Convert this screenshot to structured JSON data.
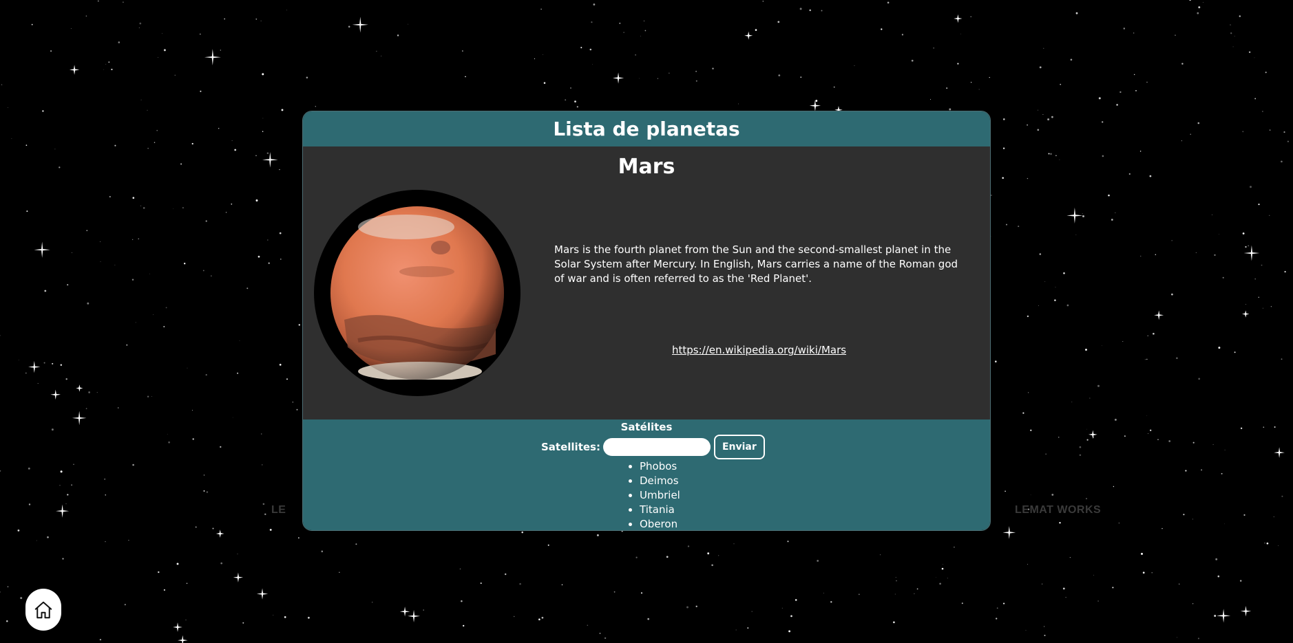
{
  "header": {
    "title": "Lista de planetas"
  },
  "planet": {
    "name": "Mars",
    "description": "Mars is the fourth planet from the Sun and the second-smallest planet in the Solar System after Mercury. In English, Mars carries a name of the Roman god of war and is often referred to as the 'Red Planet'.",
    "link": "https://en.wikipedia.org/wiki/Mars"
  },
  "satellites": {
    "title": "Satélites",
    "label": "Satellites:",
    "input_value": "",
    "button_label": "Enviar",
    "items": [
      "Phobos",
      "Deimos",
      "Umbriel",
      "Titania",
      "Oberon"
    ]
  },
  "watermarks": {
    "left": "LE",
    "right": "LEMAT WORKS"
  },
  "icons": {
    "home": "home-icon"
  },
  "colors": {
    "accent": "#2e6a72",
    "panel": "#2f2f2f",
    "background": "#000000"
  }
}
